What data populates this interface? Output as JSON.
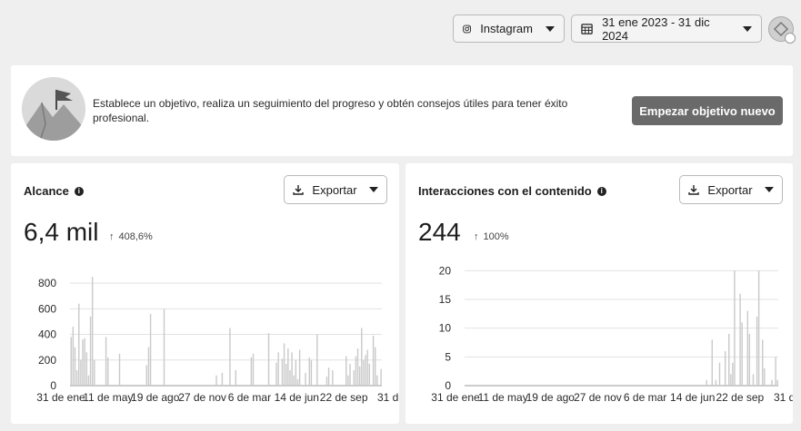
{
  "header": {
    "platform_label": "Instagram",
    "date_range": "31 ene 2023 - 31 dic 2024"
  },
  "goal": {
    "text": "Establece un objetivo, realiza un seguimiento del progreso y obtén consejos útiles para tener éxito profesional.",
    "button_label": "Empezar objetivo nuevo"
  },
  "panels": [
    {
      "title": "Alcance",
      "export_label": "Exportar",
      "value": "6,4 mil",
      "delta": "408,6%",
      "chart_data": {
        "type": "bar",
        "ylim": [
          0,
          900
        ],
        "yticks": [
          0,
          200,
          400,
          600,
          800
        ],
        "xtick_labels": [
          "31 de ene",
          "11 de may",
          "19 de ago",
          "27 de nov",
          "6 de mar",
          "14 de jun",
          "22 de sep",
          "31 de"
        ],
        "values": [
          380,
          460,
          300,
          120,
          640,
          200,
          360,
          370,
          260,
          80,
          540,
          850,
          200,
          0,
          0,
          0,
          0,
          0,
          380,
          220,
          0,
          0,
          0,
          0,
          0,
          250,
          0,
          0,
          0,
          0,
          0,
          0,
          0,
          0,
          0,
          0,
          0,
          0,
          0,
          160,
          300,
          560,
          0,
          0,
          0,
          0,
          0,
          0,
          600,
          0,
          0,
          0,
          0,
          0,
          0,
          0,
          0,
          0,
          0,
          0,
          0,
          0,
          0,
          0,
          0,
          0,
          0,
          0,
          0,
          0,
          0,
          0,
          0,
          0,
          0,
          80,
          0,
          0,
          100,
          0,
          0,
          0,
          450,
          0,
          0,
          120,
          0,
          0,
          0,
          0,
          0,
          0,
          0,
          220,
          250,
          0,
          0,
          0,
          0,
          0,
          0,
          0,
          410,
          0,
          0,
          0,
          180,
          260,
          0,
          210,
          330,
          170,
          290,
          120,
          260,
          80,
          200,
          50,
          280,
          0,
          0,
          100,
          0,
          220,
          200,
          0,
          0,
          400,
          0,
          0,
          0,
          0,
          70,
          140,
          0,
          120,
          0,
          0,
          0,
          0,
          0,
          0,
          230,
          80,
          170,
          0,
          120,
          230,
          290,
          150,
          450,
          200,
          240,
          280,
          170,
          0,
          390,
          300,
          80,
          0,
          130
        ]
      }
    },
    {
      "title": "Interacciones con el contenido",
      "export_label": "Exportar",
      "value": "244",
      "delta": "100%",
      "chart_data": {
        "type": "bar",
        "ylim": [
          0,
          21
        ],
        "yticks": [
          0,
          5,
          10,
          15,
          20
        ],
        "xtick_labels": [
          "31 de ene",
          "11 de may",
          "19 de ago",
          "27 de nov",
          "6 de mar",
          "14 de jun",
          "22 de sep",
          "31 de"
        ],
        "values": [
          0,
          0,
          0,
          0,
          0,
          0,
          0,
          0,
          0,
          0,
          0,
          0,
          0,
          0,
          0,
          0,
          0,
          0,
          0,
          0,
          0,
          0,
          0,
          0,
          0,
          0,
          0,
          0,
          0,
          0,
          0,
          0,
          0,
          0,
          0,
          0,
          0,
          0,
          0,
          0,
          0,
          0,
          0,
          0,
          0,
          0,
          0,
          0,
          0,
          0,
          0,
          0,
          0,
          0,
          0,
          0,
          0,
          0,
          0,
          0,
          0,
          0,
          0,
          0,
          0,
          0,
          0,
          0,
          0,
          0,
          0,
          0,
          0,
          0,
          0,
          0,
          0,
          0,
          0,
          0,
          0,
          0,
          0,
          0,
          0,
          0,
          0,
          0,
          0,
          0,
          0,
          0,
          0,
          0,
          0,
          0,
          0,
          0,
          0,
          0,
          0,
          0,
          0,
          0,
          0,
          0,
          0,
          0,
          0,
          0,
          0,
          0,
          0,
          0,
          0,
          0,
          0,
          0,
          0,
          0,
          0,
          0,
          0,
          0,
          0,
          0,
          0,
          0,
          0,
          1,
          0,
          0,
          8,
          0,
          1,
          0,
          4,
          0,
          0,
          6,
          0,
          9,
          2,
          4,
          20,
          0,
          0,
          16,
          11,
          0,
          0,
          13,
          9,
          0,
          2,
          0,
          12,
          20,
          0,
          8,
          3,
          0,
          0,
          0,
          1,
          0,
          5,
          1
        ]
      }
    }
  ]
}
